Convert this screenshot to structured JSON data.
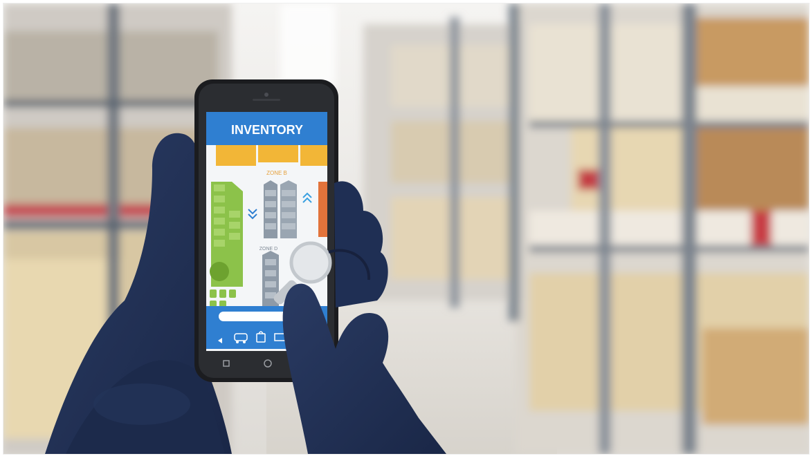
{
  "app": {
    "title": "INVENTORY",
    "zones": [
      "ZONE B",
      "ZONE D"
    ]
  },
  "colors": {
    "header_blue": "#2f7fd1",
    "zone_yellow": "#f2b637",
    "zone_green": "#8cc24a",
    "zone_grey": "#8e9aa7",
    "zone_orange": "#e2733b",
    "glove_navy": "#1f2f54"
  },
  "icons": [
    "back-arrow-icon",
    "car-icon",
    "bag-icon",
    "truck-icon",
    "square-nav-icon",
    "circle-nav-icon",
    "magnifier-icon",
    "chevron-down-icon",
    "chevron-up-icon"
  ]
}
